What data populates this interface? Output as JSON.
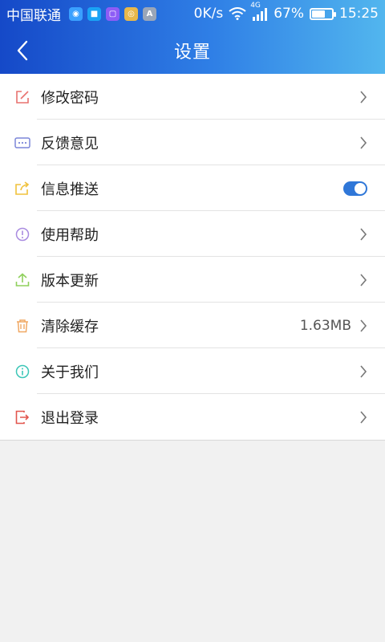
{
  "status_bar": {
    "carrier": "中国联通",
    "app_icons": [
      {
        "icon": "map-pin-app-icon",
        "color": "#3aa0ff",
        "glyph": "◉"
      },
      {
        "icon": "chat-app-icon",
        "color": "#1aa3f5",
        "glyph": "◼"
      },
      {
        "icon": "gallery-app-icon",
        "color": "#8d5cf6",
        "glyph": "▢"
      },
      {
        "icon": "weibo-app-icon",
        "color": "#e8b84a",
        "glyph": "◎"
      },
      {
        "icon": "font-app-icon",
        "color": "#9aa6b8",
        "glyph": "A"
      }
    ],
    "net_speed": "0K/s",
    "network_type": "4G",
    "battery_percent": "67%",
    "battery_level": 0.67,
    "time": "15:25"
  },
  "header": {
    "title": "设置",
    "back_icon": "back-arrow-icon"
  },
  "menu": {
    "items": [
      {
        "label": "修改密码",
        "icon": "edit-password-icon",
        "icon_color": "#e8726f",
        "right": "chevron"
      },
      {
        "label": "反馈意见",
        "icon": "feedback-icon",
        "icon_color": "#7b86d8",
        "right": "chevron"
      },
      {
        "label": "信息推送",
        "icon": "push-notification-icon",
        "icon_color": "#f0c23c",
        "right": "toggle",
        "toggle_on": true
      },
      {
        "label": "使用帮助",
        "icon": "help-icon",
        "icon_color": "#a98be0",
        "right": "chevron"
      },
      {
        "label": "版本更新",
        "icon": "upload-update-icon",
        "icon_color": "#8fd05c",
        "right": "chevron"
      },
      {
        "label": "清除缓存",
        "icon": "trash-icon",
        "icon_color": "#f0a863",
        "right": "chevron",
        "value": "1.63MB"
      },
      {
        "label": "关于我们",
        "icon": "info-icon",
        "icon_color": "#3cc6b7",
        "right": "chevron"
      },
      {
        "label": "退出登录",
        "icon": "logout-icon",
        "icon_color": "#e2564e",
        "right": "chevron"
      }
    ]
  },
  "colors": {
    "header_gradient_start": "#1549c8",
    "header_gradient_end": "#52b6ee",
    "toggle_on": "#2f77d8",
    "background": "#f1f1f1"
  }
}
